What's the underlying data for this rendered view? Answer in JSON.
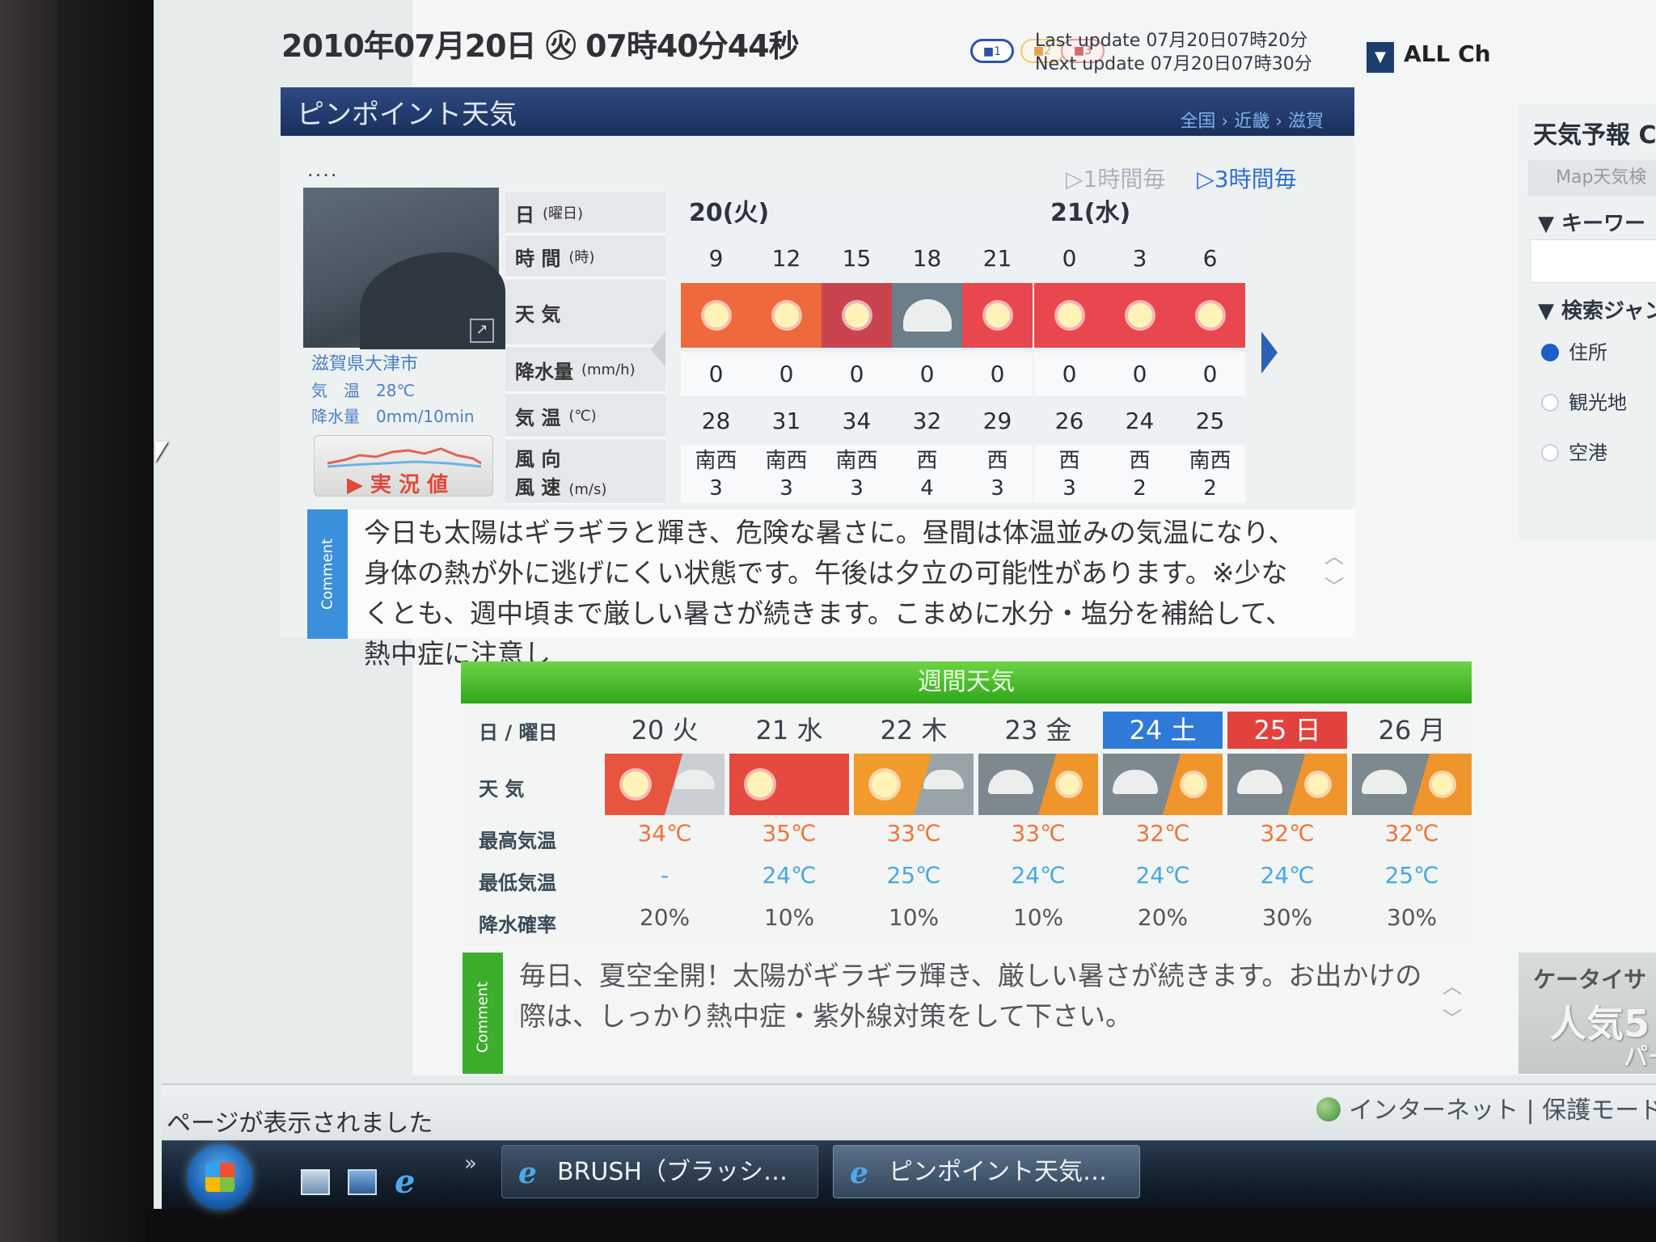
{
  "top_bar": {
    "datetime": "2010年07月20日 ㊋ 07時40分44秒",
    "pills": [
      "■1",
      "■2",
      "■3"
    ],
    "last_update": "Last update  07月20日07時20分",
    "next_update": "Next update  07月20日07時30分",
    "all_channel": "ALL Ch"
  },
  "pinpoint": {
    "title": "ピンポイント天気",
    "breadcrumb": "全国 › 近畿 › 滋賀",
    "dots": "....",
    "toggle_1h": "▷1時間毎",
    "toggle_3h": "▷3時間毎",
    "location": "滋賀県大津市",
    "temp_line": "気　温　28℃",
    "rain_line": "降水量　0mm/10min",
    "actual_button": "▶ 実 況 値",
    "row_labels": {
      "day": "日",
      "day_unit": "(曜日)",
      "time": "時 間",
      "time_unit": "(時)",
      "weather": "天 気",
      "precip": "降水量",
      "precip_unit": "(mm/h)",
      "temp": "気 温",
      "temp_unit": "(℃)",
      "wind_dir": "風 向",
      "wind_speed": "風 速",
      "wind_unit": "(m/s)"
    },
    "days": [
      "20(火)",
      "21(水)"
    ],
    "hours": [
      "9",
      "12",
      "15",
      "18",
      "21",
      "0",
      "3",
      "6"
    ],
    "weather_icons": [
      "sun-icon",
      "sun-icon",
      "sun-icon",
      "cloud-icon",
      "sun-icon",
      "sun-icon",
      "sun-icon",
      "sun-icon"
    ],
    "icon_colors": [
      "#ee6a3c",
      "#ee6a3c",
      "#c9444e",
      "#6c7e8a",
      "#e8474e",
      "#e8474e",
      "#e8474e",
      "#e8474e"
    ],
    "precip": [
      "0",
      "0",
      "0",
      "0",
      "0",
      "0",
      "0",
      "0"
    ],
    "temp": [
      "28",
      "31",
      "34",
      "32",
      "29",
      "26",
      "24",
      "25"
    ],
    "wind_dir": [
      "南西",
      "南西",
      "南西",
      "西",
      "西",
      "西",
      "西",
      "南西"
    ],
    "wind_speed": [
      "3",
      "3",
      "3",
      "4",
      "3",
      "3",
      "2",
      "2"
    ],
    "comment_label": "Comment",
    "comment": "今日も太陽はギラギラと輝き、危険な暑さに。昼間は体温並みの気温になり、身体の熱が外に逃げにくい状態です。午後は夕立の可能性があります。※少なくとも、週中頃まで厳しい暑さが続きます。こまめに水分・塩分を補給して、熱中症に注意し"
  },
  "weekly": {
    "title": "週間天気",
    "labels": {
      "day": "日 / 曜日",
      "weather": "天 気",
      "max": "最高気温",
      "min": "最低気温",
      "pop": "降水確率"
    },
    "days": [
      "20 火",
      "21 水",
      "22 木",
      "23 金",
      "24 土",
      "25 日",
      "26 月"
    ],
    "day_colors": [
      "none",
      "none",
      "none",
      "none",
      "#2f7ad6",
      "#e2423d",
      "none"
    ],
    "icons": [
      {
        "left": "sun-icon",
        "right": "cloud-icon",
        "color_left": "#e8553e",
        "color_right": "#c9cfd2"
      },
      {
        "left": "sun-icon",
        "right": "",
        "color_left": "#e44a3e",
        "color_right": "#e44a3e"
      },
      {
        "left": "sun-icon",
        "right": "cloud-icon",
        "color_left": "#f29a2b",
        "color_right": "#9aa3a8"
      },
      {
        "left": "cloud-icon",
        "right": "sun-icon",
        "color_left": "#7d898f",
        "color_right": "#f0952c"
      },
      {
        "left": "cloud-icon",
        "right": "sun-icon",
        "color_left": "#7d898f",
        "color_right": "#f0952c"
      },
      {
        "left": "cloud-icon",
        "right": "sun-icon",
        "color_left": "#7d898f",
        "color_right": "#f0952c"
      },
      {
        "left": "cloud-icon",
        "right": "sun-icon",
        "color_left": "#7d898f",
        "color_right": "#f0952c"
      }
    ],
    "max": [
      "34℃",
      "35℃",
      "33℃",
      "33℃",
      "32℃",
      "32℃",
      "32℃"
    ],
    "min": [
      "-",
      "24℃",
      "25℃",
      "24℃",
      "24℃",
      "24℃",
      "25℃"
    ],
    "pop": [
      "20%",
      "10%",
      "10%",
      "10%",
      "20%",
      "30%",
      "30%"
    ],
    "comment_label": "Comment",
    "comment": "毎日、夏空全開！太陽がギラギラ輝き、厳しい暑さが続きます。お出かけの際は、しっかり熱中症・紫外線対策をして下さい。"
  },
  "sidebar": {
    "title": "天気予報 Ch",
    "map_link": "Map天気検",
    "keyword": "▼ キーワー",
    "genre": "▼ 検索ジャン",
    "radios": [
      "住所",
      "観光地",
      "空港"
    ],
    "ad_line1": "ケータイサ",
    "ad_line2": "人気5",
    "ad_line3": "パー"
  },
  "browser": {
    "status": "ページが表示されました",
    "zone": "インターネット | 保護モード"
  },
  "taskbar": {
    "quick_launch": [
      "show-desktop-icon",
      "switch-windows-icon",
      "ie-icon"
    ],
    "chevron": "»",
    "tasks": [
      "BRUSH（ブラッシ…",
      "ピンポイント天気…"
    ]
  }
}
